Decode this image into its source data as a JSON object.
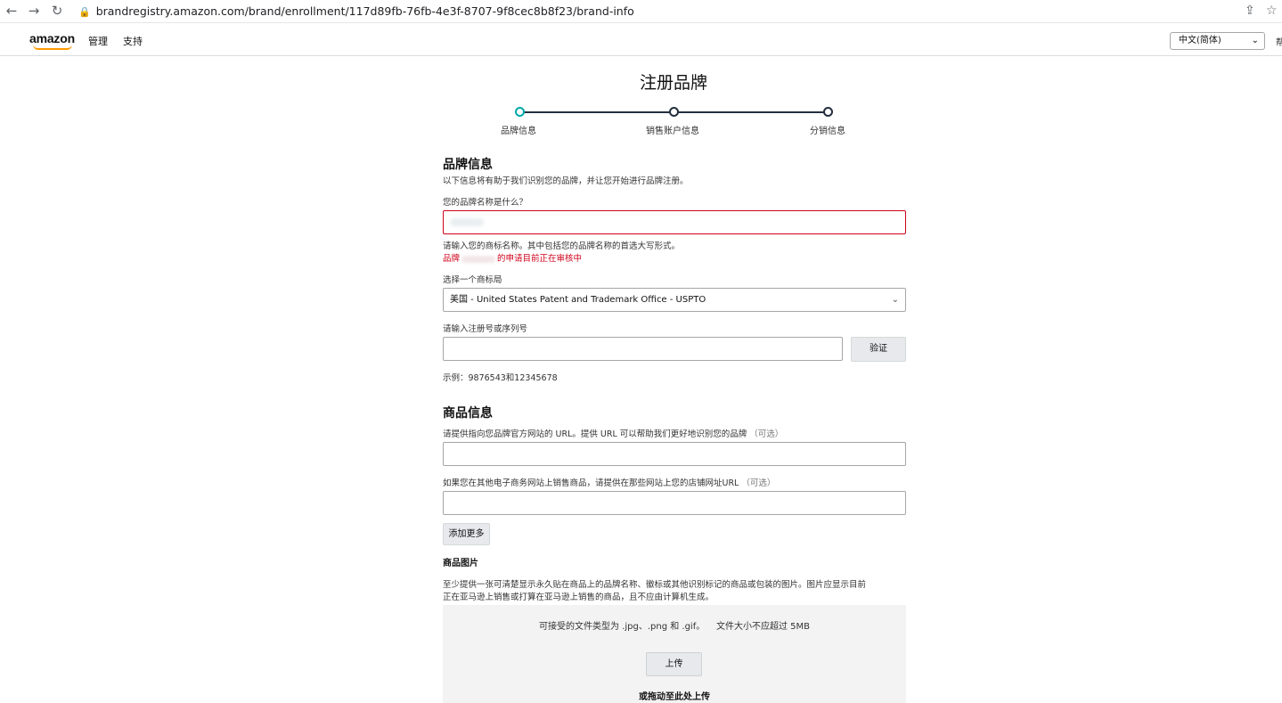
{
  "browser": {
    "back": "←",
    "forward": "→",
    "reload": "↻",
    "url": "brandregistry.amazon.com/brand/enrollment/117d89fb-76fb-4e3f-8707-9f8cec8b8f23/brand-info",
    "share": "⇪",
    "star": "☆"
  },
  "header": {
    "logo": "amazon",
    "nav": [
      "管理",
      "支持"
    ],
    "language": "中文(简体)",
    "help_cut": "帮"
  },
  "page": {
    "title": "注册品牌",
    "steps": [
      "品牌信息",
      "销售账户信息",
      "分销信息"
    ]
  },
  "brand_info": {
    "heading": "品牌信息",
    "intro": "以下信息将有助于我们识别您的品牌，并让您开始进行品牌注册。",
    "name_label": "您的品牌名称是什么？",
    "name_help": "请输入您的商标名称。其中包括您的品牌名称的首选大写形式。",
    "name_error_prefix": "品牌",
    "name_error_suffix": "的申请目前正在审核中",
    "office_label": "选择一个商标局",
    "office_value": "美国 - United States Patent and Trademark Office - USPTO",
    "reg_label": "请输入注册号或序列号",
    "verify_button": "验证",
    "reg_example": "示例：9876543和12345678"
  },
  "product_info": {
    "heading": "商品信息",
    "website_label": "请提供指向您品牌官方网站的 URL。提供 URL 可以帮助我们更好地识别您的品牌",
    "website_optional": "（可选）",
    "store_label": "如果您在其他电子商务网站上销售商品，请提供在那些网站上您的店铺网址URL",
    "store_optional": "（可选）",
    "add_more_button": "添加更多",
    "images_heading": "商品图片",
    "images_desc_1": "至少提供一张可清楚显示永久贴在商品上的品牌名称、徽标或其他识别标记的商品或包装的图片。图片应显示目前",
    "images_desc_2": "正在亚马逊上销售或打算在亚马逊上销售的商品，且不应由计算机生成。",
    "file_types": "可接受的文件类型为 .jpg、.png 和 .gif。",
    "file_size": "文件大小不应超过 5MB",
    "upload_button": "上传",
    "drag_text": "或拖动至此处上传"
  }
}
